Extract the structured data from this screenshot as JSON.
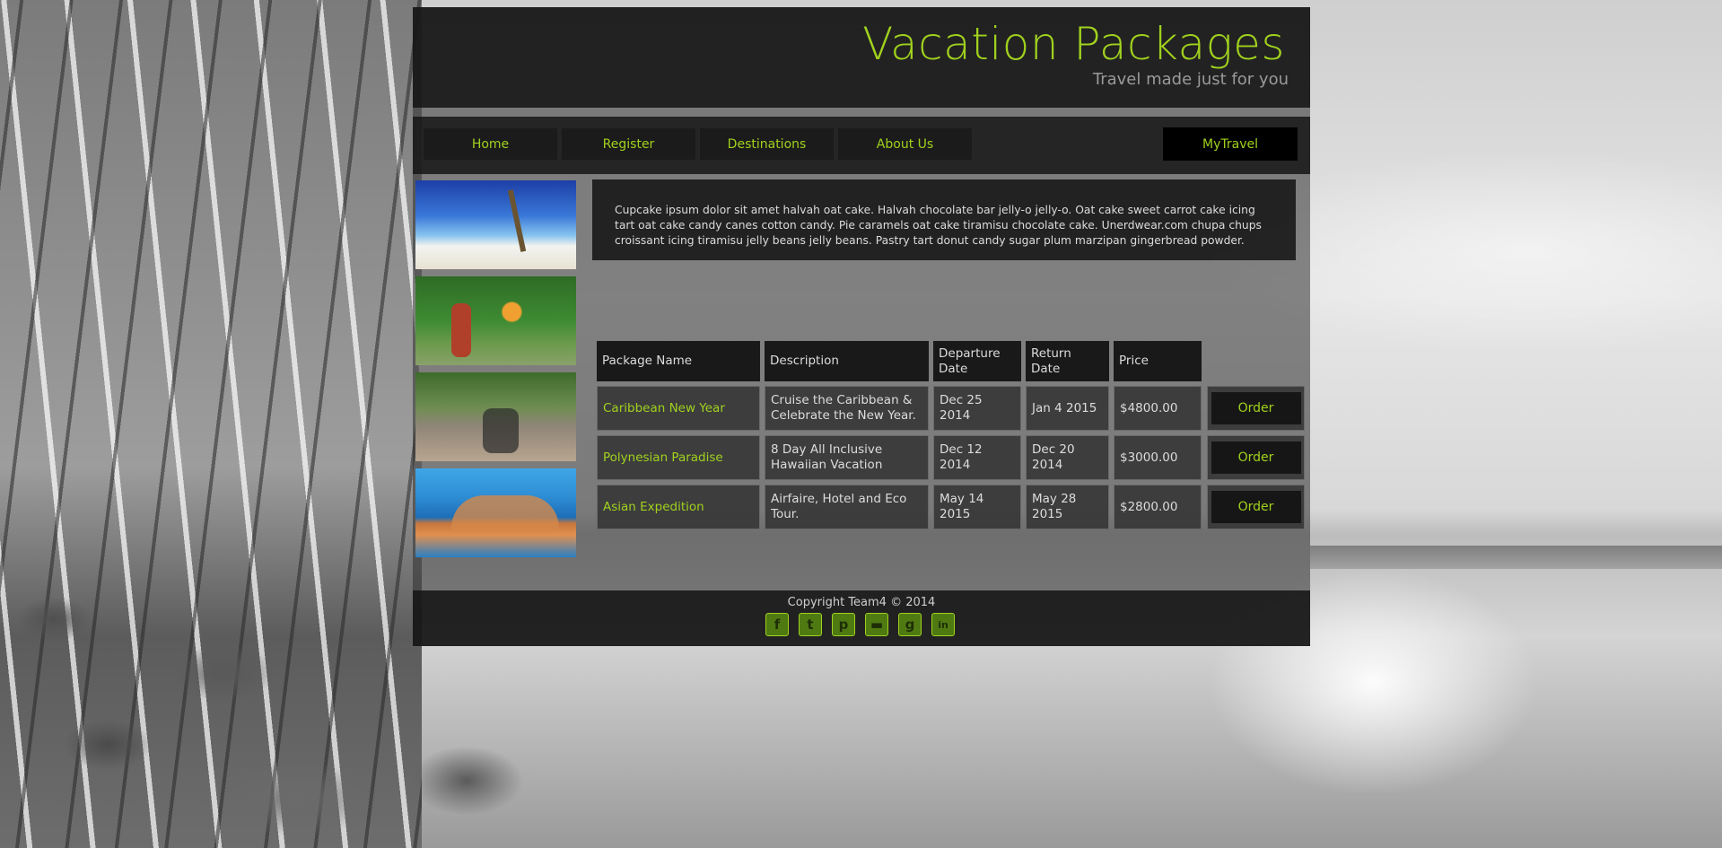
{
  "header": {
    "title": "Vacation Packages",
    "subtitle": "Travel made just for you"
  },
  "nav": {
    "items": [
      {
        "label": "Home"
      },
      {
        "label": "Register"
      },
      {
        "label": "Destinations"
      },
      {
        "label": "About Us"
      }
    ],
    "mytravel_label": "MyTravel"
  },
  "intro": {
    "text": "Cupcake ipsum dolor sit amet halvah oat cake. Halvah chocolate bar jelly-o jelly-o. Oat cake sweet carrot cake icing tart oat cake candy canes cotton candy. Pie caramels oat cake tiramisu chocolate cake. Unerdwear.com chupa chups croissant icing tiramisu jelly beans jelly beans. Pastry tart donut candy sugar plum marzipan gingerbread powder."
  },
  "thumbnails": [
    {
      "icon": "beach-photo"
    },
    {
      "icon": "fire-dancers-photo"
    },
    {
      "icon": "cyclists-photo"
    },
    {
      "icon": "coastal-city-photo"
    }
  ],
  "packages_table": {
    "headers": [
      "Package Name",
      "Description",
      "Departure Date",
      "Return Date",
      "Price"
    ],
    "rows": [
      {
        "name": "Caribbean New Year",
        "description": "Cruise the Caribbean & Celebrate the New Year.",
        "departure": "Dec 25 2014",
        "return": "Jan 4 2015",
        "price": "$4800.00",
        "action": "Order"
      },
      {
        "name": "Polynesian Paradise",
        "description": "8 Day All Inclusive Hawaiian Vacation",
        "departure": "Dec 12 2014",
        "return": "Dec 20 2014",
        "price": "$3000.00",
        "action": "Order"
      },
      {
        "name": "Asian Expedition",
        "description": "Airfaire, Hotel and Eco Tour.",
        "departure": "May 14 2015",
        "return": "May 28 2015",
        "price": "$2800.00",
        "action": "Order"
      }
    ]
  },
  "footer": {
    "copyright": "Copyright Team4 © 2014",
    "social_icons": [
      {
        "name": "facebook-icon",
        "glyph": "f"
      },
      {
        "name": "twitter-icon",
        "glyph": "t"
      },
      {
        "name": "pinterest-icon",
        "glyph": "p"
      },
      {
        "name": "youtube-icon",
        "glyph": "▬"
      },
      {
        "name": "google-plus-icon",
        "glyph": "g"
      },
      {
        "name": "linkedin-icon",
        "glyph": "in"
      }
    ]
  },
  "colors": {
    "accent": "#a0d11e",
    "panel": "#161616",
    "text": "#dcdcdc"
  }
}
